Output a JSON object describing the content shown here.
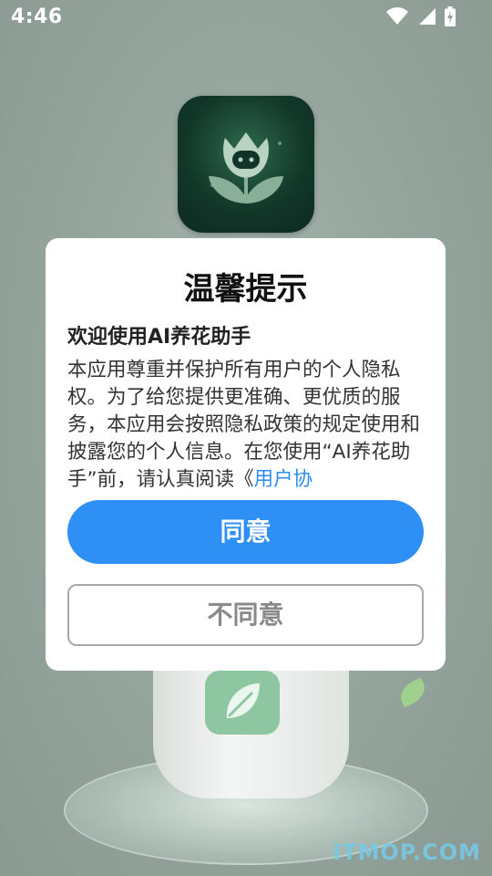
{
  "status_bar": {
    "time": "4:46",
    "icons": [
      "wifi-icon",
      "signal-icon",
      "battery-charging-icon"
    ]
  },
  "app": {
    "icon_name": "flower-logo-icon"
  },
  "dialog": {
    "title": "温馨提示",
    "subtitle": "欢迎使用AI养花助手",
    "body_text": "本应用尊重并保护所有用户的个人隐私权。为了给您提供更准确、更优质的服务，本应用会按照隐私政策的规定使用和披露您的个人信息。在您使用“AI养花助手”前，请认真阅读《",
    "body_link": "用户协",
    "agree_label": "同意",
    "disagree_label": "不同意"
  },
  "watermark": "ITMOP.COM",
  "colors": {
    "accent": "#2e8ff5",
    "link": "#2c8cf4",
    "dialog_bg": "#ffffff",
    "disagree_text": "#8a8a8a"
  }
}
